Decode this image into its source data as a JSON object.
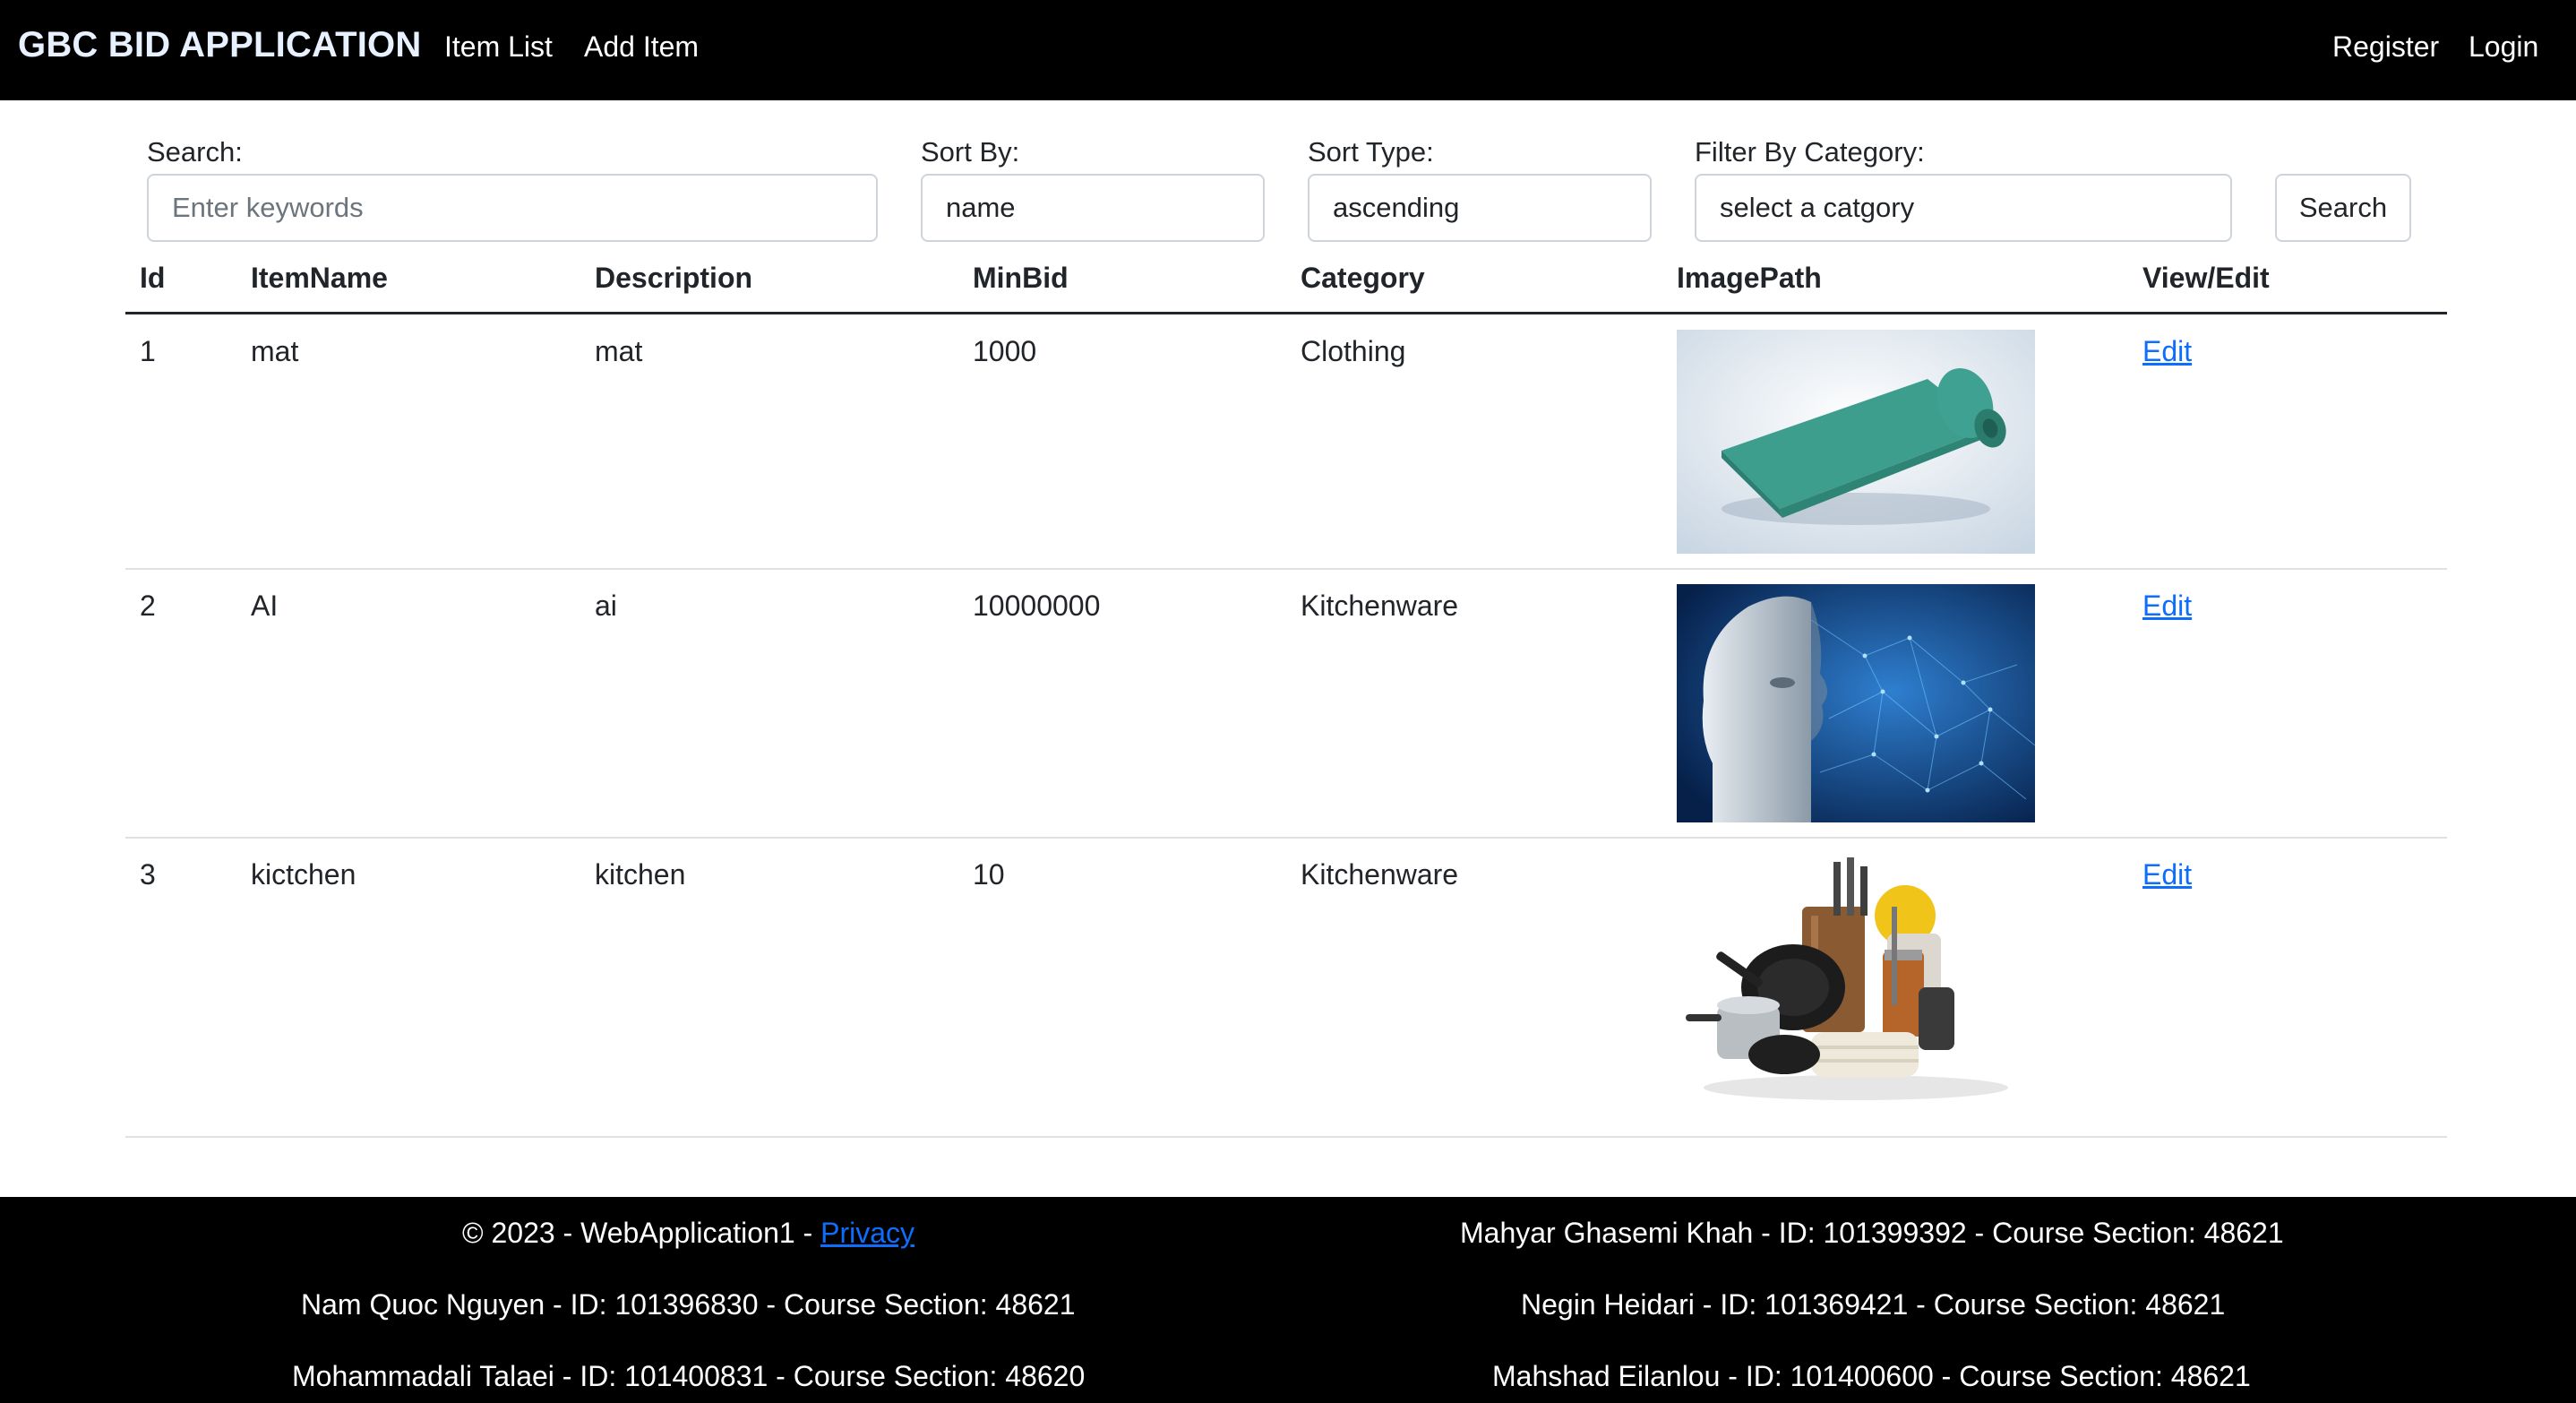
{
  "navbar": {
    "brand": "GBC BID APPLICATION",
    "links": [
      "Item List",
      "Add Item"
    ],
    "right_links": [
      "Register",
      "Login"
    ]
  },
  "filters": {
    "search_label": "Search:",
    "search_placeholder": "Enter keywords",
    "sort_by_label": "Sort By:",
    "sort_by_value": "name",
    "sort_type_label": "Sort Type:",
    "sort_type_value": "ascending",
    "category_label": "Filter By Category:",
    "category_value": "select a catgory",
    "search_button": "Search"
  },
  "table": {
    "headers": [
      "Id",
      "ItemName",
      "Description",
      "MinBid",
      "Category",
      "ImagePath",
      "View/Edit"
    ],
    "rows": [
      {
        "id": "1",
        "name": "mat",
        "description": "mat",
        "minbid": "1000",
        "category": "Clothing",
        "image": "yoga-mat-image",
        "action": "Edit"
      },
      {
        "id": "2",
        "name": "AI",
        "description": "ai",
        "minbid": "10000000",
        "category": "Kitchenware",
        "image": "ai-head-image",
        "action": "Edit"
      },
      {
        "id": "3",
        "name": "kictchen",
        "description": "kitchen",
        "minbid": "10",
        "category": "Kitchenware",
        "image": "kitchenware-image",
        "action": "Edit"
      }
    ]
  },
  "footer": {
    "copyright": "© 2023 - WebApplication1 - ",
    "privacy": "Privacy",
    "members": [
      "Mahyar Ghasemi Khah - ID: 101399392 - Course Section: 48621",
      "Nam Quoc Nguyen - ID: 101396830 - Course Section: 48621",
      "Negin Heidari - ID: 101369421 - Course Section: 48621",
      "Mohammadali Talaei - ID: 101400831 - Course Section: 48620",
      "Mahshad Eilanlou - ID: 101400600 - Course Section: 48621"
    ]
  },
  "colors": {
    "navbar_bg": "#000000",
    "link": "#0d6efd",
    "brand": "#e7f1ff"
  }
}
